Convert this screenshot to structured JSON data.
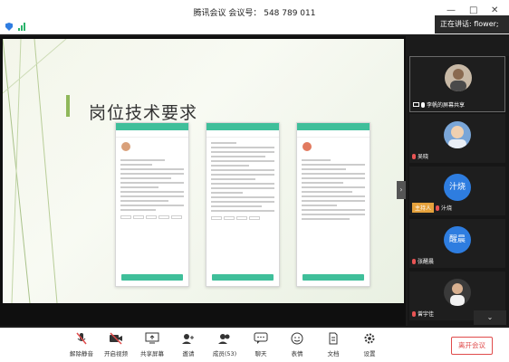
{
  "window": {
    "title": "腾讯会议  会议号：  548 789 011"
  },
  "speaking": "正在讲话: flower;",
  "slide": {
    "title": "岗位技术要求"
  },
  "participants": [
    {
      "name": "李帆的屏幕共享",
      "avatar_text": ""
    },
    {
      "name": "吴晓",
      "avatar_text": ""
    },
    {
      "name": "汁烧",
      "avatar_text": "汁烧",
      "badge": "主持人"
    },
    {
      "name": "张醒晨",
      "avatar_text": "醒晨"
    },
    {
      "name": "曾宇佳",
      "avatar_text": ""
    }
  ],
  "toolbar": {
    "mute": "解除静音",
    "video": "开启视频",
    "share": "共享屏幕",
    "invite": "邀请",
    "members": "成员(53)",
    "chat": "聊天",
    "reaction": "表情",
    "docs": "文档",
    "settings": "设置",
    "leave": "离开会议"
  },
  "colors": {
    "accent": "#2f7de1",
    "leave": "#e04b4b",
    "phone_header": "#3fbf9a"
  }
}
